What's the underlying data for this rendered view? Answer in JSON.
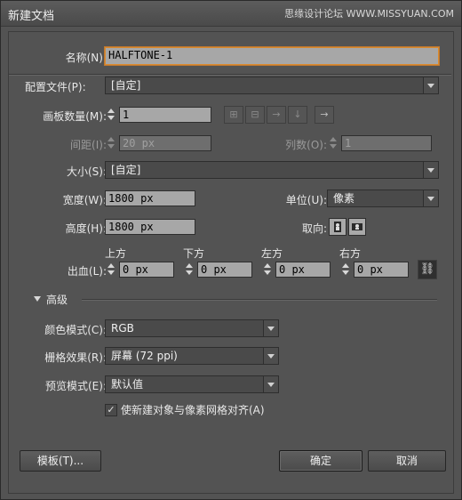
{
  "window": {
    "title": "新建文档",
    "watermark": "思缘设计论坛 WWW.MISSYUAN.COM"
  },
  "name": {
    "label": "名称(N):",
    "value": "HALFTONE-1"
  },
  "profile": {
    "label": "配置文件(P):",
    "value": "[自定]"
  },
  "artboards": {
    "label": "画板数量(M):",
    "value": "1"
  },
  "spacing": {
    "label": "间距(I):",
    "value": "20 px"
  },
  "columns": {
    "label": "列数(O):",
    "value": "1"
  },
  "size": {
    "label": "大小(S):",
    "value": "[自定]"
  },
  "width": {
    "label": "宽度(W):",
    "value": "1800 px"
  },
  "units": {
    "label": "单位(U):",
    "value": "像素"
  },
  "height": {
    "label": "高度(H):",
    "value": "1800 px"
  },
  "orientation": {
    "label": "取向:"
  },
  "bleed": {
    "label": "出血(L):",
    "top": {
      "label": "上方",
      "value": "0 px"
    },
    "bottom": {
      "label": "下方",
      "value": "0 px"
    },
    "left": {
      "label": "左方",
      "value": "0 px"
    },
    "right": {
      "label": "右方",
      "value": "0 px"
    }
  },
  "advanced": {
    "label": "高级"
  },
  "color_mode": {
    "label": "颜色模式(C):",
    "value": "RGB"
  },
  "raster": {
    "label": "栅格效果(R):",
    "value": "屏幕 (72 ppi)"
  },
  "preview": {
    "label": "预览模式(E):",
    "value": "默认值"
  },
  "align": {
    "label": "使新建对象与像素网格对齐(A)",
    "check": "✓"
  },
  "buttons": {
    "templates": "模板(T)...",
    "ok": "确定",
    "cancel": "取消"
  },
  "arrange_icons": [
    "grid-by-row-icon",
    "grid-by-column-icon",
    "arrange-by-row-icon",
    "arrange-by-column-icon",
    "change-layout-icon"
  ]
}
